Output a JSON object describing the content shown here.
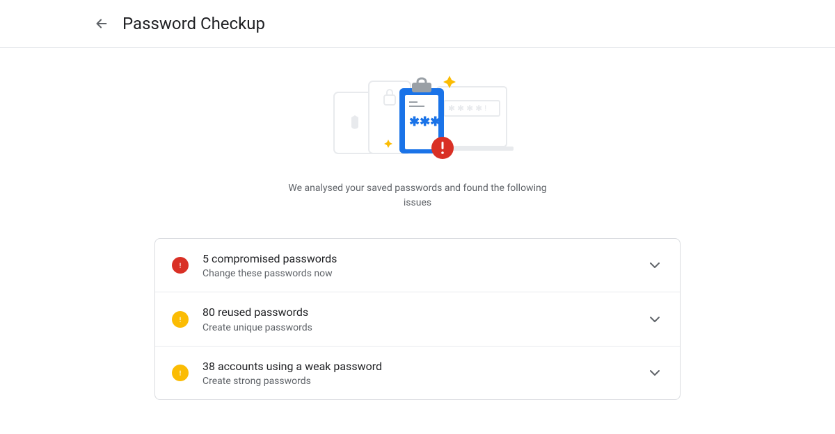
{
  "header": {
    "title": "Password Checkup"
  },
  "hero": {
    "subtitle": "We analysed your saved passwords and found the following issues"
  },
  "issues": [
    {
      "severity": "red",
      "title": "5 compromised passwords",
      "subtitle": "Change these passwords now"
    },
    {
      "severity": "yellow",
      "title": "80 reused passwords",
      "subtitle": "Create unique passwords"
    },
    {
      "severity": "yellow",
      "title": "38 accounts using a weak password",
      "subtitle": "Create strong passwords"
    }
  ]
}
